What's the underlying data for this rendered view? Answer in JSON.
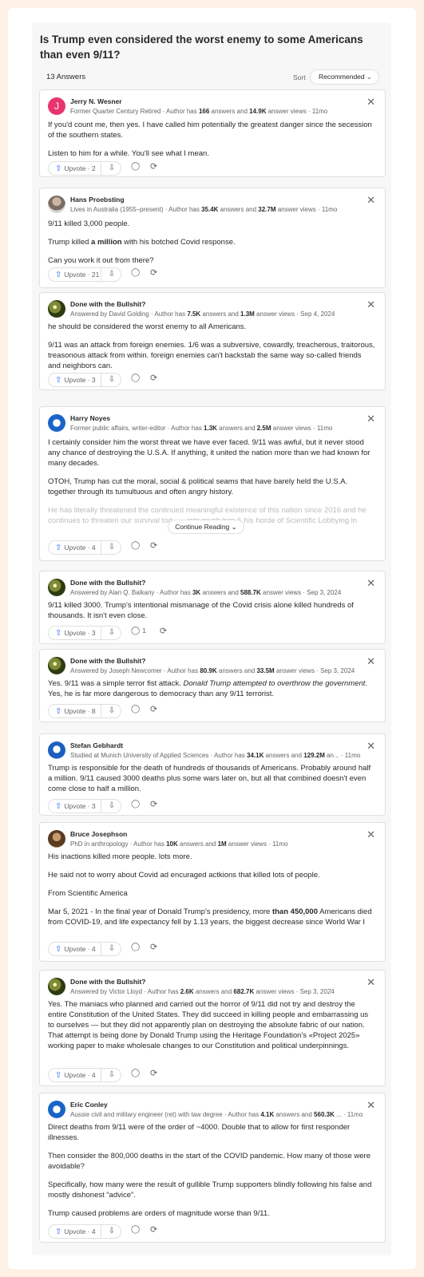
{
  "question": {
    "title": "Is Trump even considered the worst enemy to some Americans than even 9/11?"
  },
  "list_header": {
    "answers_count": "13 Answers",
    "sort_label": "Sort",
    "sort_value": "Recommended"
  },
  "colors": {
    "upvote_icon": "#2e69ff",
    "page_bg": "#fdf1e6",
    "avatar_pink": "#e8356d"
  },
  "answers": [
    {
      "author": "Jerry N. Wesner",
      "cred_prefix": "Former Quarter Century Retired · Author has ",
      "answers_num": "166",
      "mid": " answers and ",
      "views_num": "14.9K",
      "suffix": " answer views · 11mo",
      "paragraphs": [
        "If you'd count me, then yes. I have called him potentially the greatest danger since the secession of the southern states.",
        "Listen to him for a while. You'll see what I mean."
      ],
      "upvote": "Upvote · 2",
      "avatar_letter": "J"
    },
    {
      "author": "Hans Proebsting",
      "cred_prefix": "Lives in Australia (1955–present) · Author has ",
      "answers_num": "35.4K",
      "mid": " answers and ",
      "views_num": "32.7M",
      "suffix": " answer views · 11mo",
      "p1": "9/11 killed 3,000 people.",
      "p2a": "Trump killed ",
      "p2b": "a million",
      "p2c": " with his botched Covid response.",
      "p3": "Can you work it out from there?",
      "upvote": "Upvote · 21"
    },
    {
      "author": "Done with the Bullshit?",
      "cred_prefix": "Answered by David Golding · Author has ",
      "answers_num": "7.5K",
      "mid": " answers and ",
      "views_num": "1.3M",
      "suffix": " answer views · Sep 4, 2024",
      "paragraphs": [
        "he should be considered the worst enemy to all Americans.",
        "9/11 was an attack from foreign enemies. 1/6 was a subversive, cowardly, treacherous, traitorous, treasonous attack from within. foreign enemies can't backstab the same way so-called friends and neighbors can."
      ],
      "upvote": "Upvote · 3"
    },
    {
      "author": "Harry Noyes",
      "cred_prefix": "Former public affairs, writer-editor · Author has ",
      "answers_num": "1.3K",
      "mid": " answers and ",
      "views_num": "2.5M",
      "suffix": " answer views · 11mo",
      "paragraphs": [
        "I certainly consider him the worst threat we have ever faced. 9/11 was awful, but it never stood any chance of destroying the U.S.A. If anything, it united the nation more than we had known for many decades.",
        "OTOH, Trump has cut the moral, social & political seams that have barely held the U.S.A. together through its tumultuous and often angry history."
      ],
      "faded": "He has literally threatened the continued meaningful existence of this nation since 2016 and he continues to threaten our survival tod... ...rats crush him & his horde of Scientific Lobbying in November, th... ...s uncertain.",
      "continue": "Continue Reading",
      "upvote": "Upvote · 4"
    },
    {
      "author": "Done with the Bullshit?",
      "cred_prefix": "Answered by Alan Q. Balkany · Author has ",
      "answers_num": "3K",
      "mid": " answers and ",
      "views_num": "588.7K",
      "suffix": " answer views · Sep 3, 2024",
      "paragraphs": [
        "9/11 killed 3000. Trump's intentional mismanage of the Covid crisis alone killed hundreds of thousands. It isn't even close."
      ],
      "upvote": "Upvote · 3",
      "comments": "1"
    },
    {
      "author": "Done with the Bullshit?",
      "cred_prefix": "Answered by Joseph Newcomer · Author has ",
      "answers_num": "80.9K",
      "mid": " answers and ",
      "views_num": "33.5M",
      "suffix": " answer views · Sep 3, 2024",
      "p1a": "Yes. 9/11 was a simple terror fist attack. ",
      "p1b": "Donald Trump attempted to overthrow the government",
      "p1c": ". Yes, he is far more dangerous to democracy than any 9/11 terrorist.",
      "upvote": "Upvote · 8"
    },
    {
      "author": "Stefan Gebhardt",
      "cred_prefix": "Studied at Munich University of Applied Sciences · Author has ",
      "answers_num": "34.1K",
      "mid": " answers and ",
      "views_num": "129.2M",
      "suffix": " an... · 11mo",
      "paragraphs": [
        "Trump is responsible for the death of hundreds of thousands of Americans. Probably around half a million. 9/11 caused 3000 deaths plus some wars later on, but all that combined doesn't even come close to half a million."
      ],
      "upvote": "Upvote · 3"
    },
    {
      "author": "Bruce Josephson",
      "cred_prefix": "PhD in anthropology · Author has ",
      "answers_num": "10K",
      "mid": " answers and ",
      "views_num": "1M",
      "suffix": " answer views · 11mo",
      "p1": "His inactions killed more people. lots more.",
      "p2": "He said not to worry about Covid ad encuraged actkions that killed lots of people.",
      "p3": "From Scientific America",
      "p4a": "Mar 5, 2021 - In the final year of Donald Trump's presidency, more ",
      "p4b": "than 450,000",
      "p4c": " Americans died from COVID-19, and life expectancy fell by 1.13 years, the biggest decrease since World War I",
      "upvote": "Upvote · 4"
    },
    {
      "author": "Done with the Bullshit?",
      "cred_prefix": "Answered by Victor Lloyd · Author has ",
      "answers_num": "2.6K",
      "mid": " answers and ",
      "views_num": "682.7K",
      "suffix": " answer views · Sep 3, 2024",
      "paragraphs": [
        "Yes. The maniacs who planned and carried out the horror of 9/11 did not try and destroy the entire Constitution of the United States. They did succeed in killing people and embarrassing us to ourselves — but they did not apparently plan on destroying the absolute fabric of our nation. That attempt is being done by Donald Trump using the Heritage Foundation's «Project 2025» working paper to make wholesale changes to our Constitution and political underpinnings."
      ],
      "upvote": "Upvote · 4"
    },
    {
      "author": "Eric Conley",
      "cred_prefix": "Aussie civil and military engineer (ret) with law degree · Author has ",
      "answers_num": "4.1K",
      "mid": " answers and ",
      "views_num": "560.3K",
      "suffix": " ... · 11mo",
      "paragraphs": [
        "Direct deaths from 9/11 were of the order of ~4000. Double that to allow for first responder illnesses.",
        "Then consider the 800,000 deaths in the start of the COVID pandemic. How many of those were avoidable?",
        "Specifically, how many were the result of gullible Trump supporters blindly following his false and mostly dishonest “advice”.",
        "Trump caused problems are orders of magnitude worse than 9/11."
      ],
      "upvote": "Upvote · 4"
    }
  ]
}
